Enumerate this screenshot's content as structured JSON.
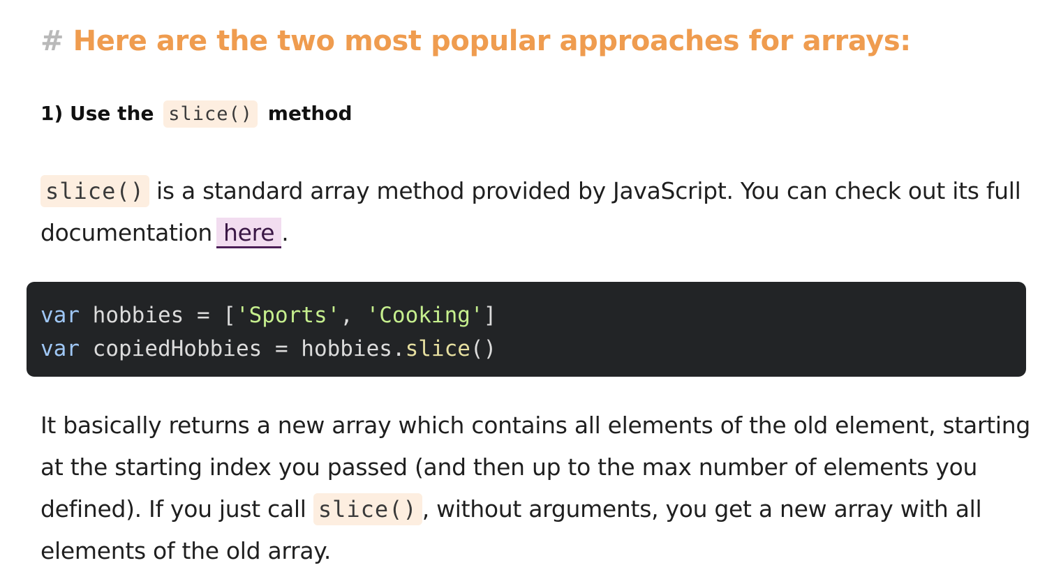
{
  "heading": {
    "hash": "#",
    "text": "Here are the two most popular approaches for arrays:"
  },
  "subheading": {
    "prefix": "1) Use the",
    "code": "slice()",
    "suffix": "method"
  },
  "paragraph1": {
    "code": "slice()",
    "text": " is a standard array method provided by JavaScript. You can check out its full documentation",
    "link_text": "here",
    "end": "."
  },
  "code_block": {
    "line1": {
      "kw": "var",
      "a": " hobbies = [",
      "s1": "'Sports'",
      "b": ", ",
      "s2": "'Cooking'",
      "c": "]"
    },
    "line2": {
      "kw": "var",
      "a": " copiedHobbies = hobbies.",
      "fn": "slice",
      "b": "()"
    }
  },
  "paragraph2": {
    "text_before": "It basically returns a new array which contains all elements of the old element, starting at the starting index you passed (and then up to the max number of elements you defined). If you just call ",
    "code": "slice()",
    "text_after": ", without arguments, you get a new array with all elements of the old array."
  },
  "colors": {
    "heading_accent": "#ef9c4f",
    "hash": "#b9b9b9",
    "inline_code_bg": "#fdeee0",
    "link_bg": "#f2ddf0",
    "link_underline": "#4b1e56",
    "code_block_bg": "#222426",
    "code_keyword": "#9fc7f5",
    "code_string": "#c6ef8e",
    "code_function": "#e6dfa0"
  }
}
